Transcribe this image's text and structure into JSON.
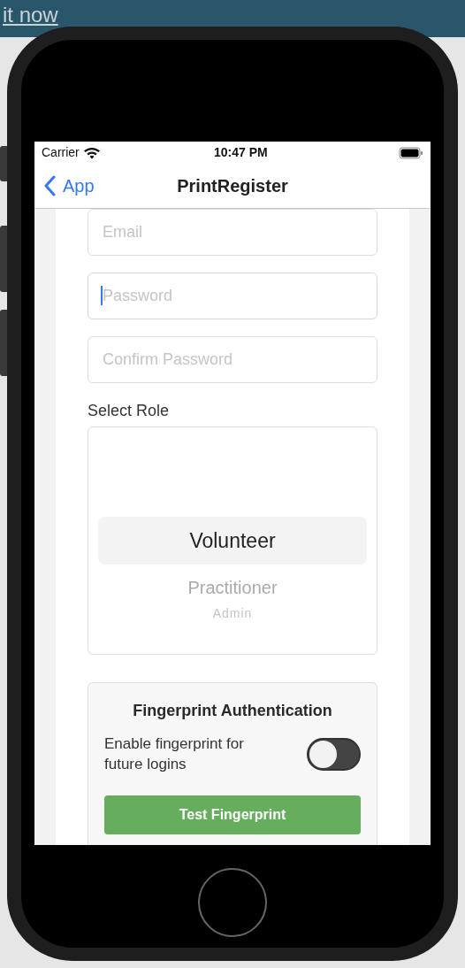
{
  "background": {
    "link": "it now"
  },
  "status_bar": {
    "carrier": "Carrier",
    "time": "10:47 PM"
  },
  "nav": {
    "back": "App",
    "title": "PrintRegister"
  },
  "fields": [
    {
      "placeholder": "Email",
      "focused": false
    },
    {
      "placeholder": "Password",
      "focused": true
    },
    {
      "placeholder": "Confirm Password",
      "focused": false
    }
  ],
  "role": {
    "label": "Select Role",
    "options": [
      {
        "label": "Volunteer",
        "selected": true
      },
      {
        "label": "Practitioner",
        "selected": false
      },
      {
        "label": "Admin",
        "selected": false
      }
    ]
  },
  "fingerprint": {
    "title": "Fingerprint Authentication",
    "toggle_label": "Enable fingerprint for future logins",
    "on": false,
    "button": "Test Fingerprint"
  }
}
